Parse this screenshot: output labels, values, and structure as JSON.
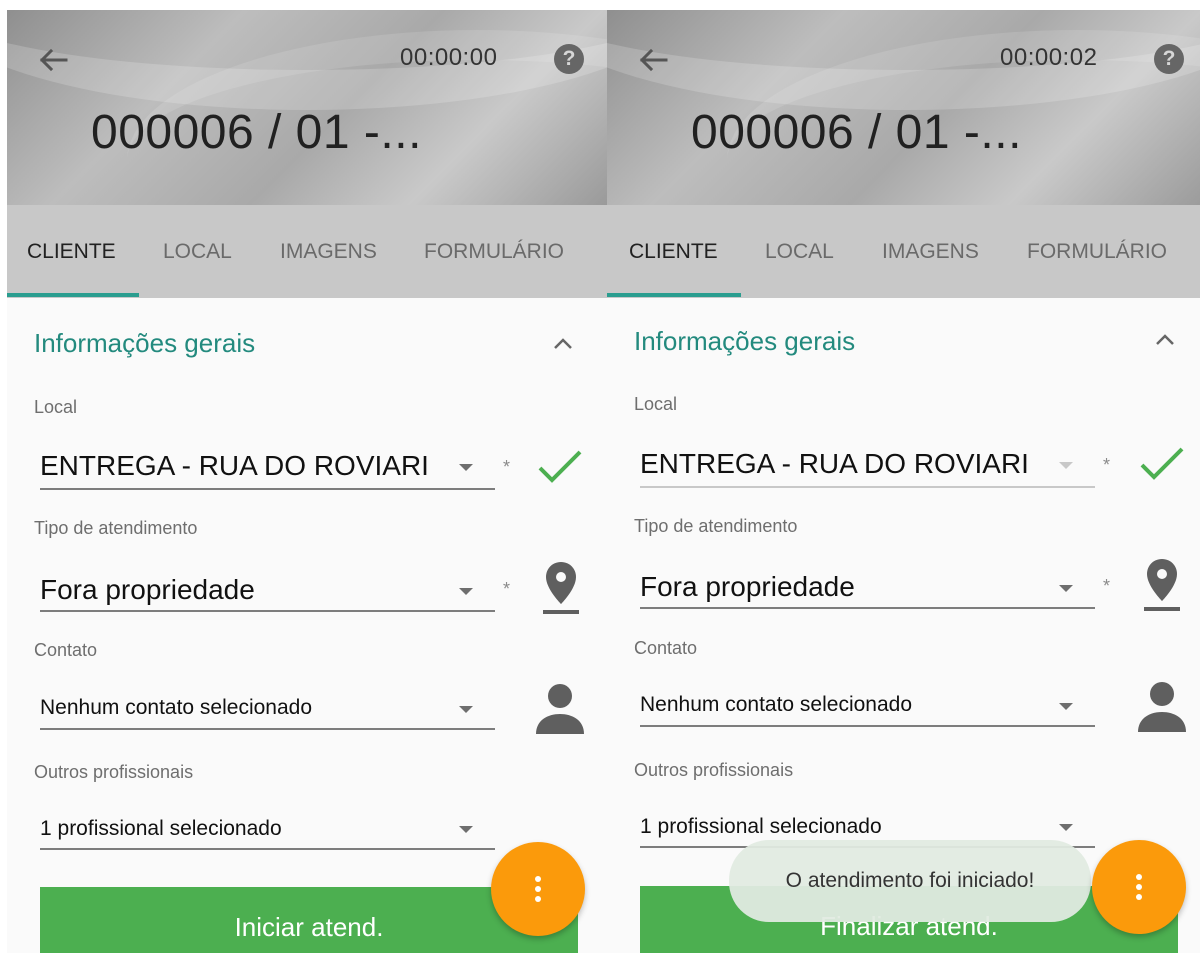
{
  "colors": {
    "accent_teal": "#238a7e",
    "primary_green": "#4caf50",
    "fab_orange": "#fb9a0b",
    "check_green": "#4caf50"
  },
  "screens": [
    {
      "timer": "00:00:00",
      "title": "000006 / 01 -...",
      "help_icon_text": "?",
      "tabs": [
        "CLIENTE",
        "LOCAL",
        "IMAGENS",
        "FORMULÁRIO"
      ],
      "active_tab": "CLIENTE",
      "section_title": "Informações gerais",
      "fields": {
        "local": {
          "label": "Local",
          "value": "ENTREGA - RUA DO ROVIARI",
          "required": "*"
        },
        "tipo": {
          "label": "Tipo de atendimento",
          "value": "Fora propriedade",
          "required": "*"
        },
        "contato": {
          "label": "Contato",
          "value": "Nenhum contato selecionado"
        },
        "outros": {
          "label": "Outros profissionais",
          "value": "1 profissional selecionado"
        }
      },
      "action_button": "Iniciar atend.",
      "toast": ""
    },
    {
      "timer": "00:00:02",
      "title": "000006 / 01 -...",
      "help_icon_text": "?",
      "tabs": [
        "CLIENTE",
        "LOCAL",
        "IMAGENS",
        "FORMULÁRIO"
      ],
      "active_tab": "CLIENTE",
      "section_title": "Informações gerais",
      "fields": {
        "local": {
          "label": "Local",
          "value": "ENTREGA - RUA DO ROVIARI",
          "required": "*"
        },
        "tipo": {
          "label": "Tipo de atendimento",
          "value": "Fora propriedade",
          "required": "*"
        },
        "contato": {
          "label": "Contato",
          "value": "Nenhum contato selecionado"
        },
        "outros": {
          "label": "Outros profissionais",
          "value": "1 profissional selecionado"
        }
      },
      "action_button": "Finalizar atend.",
      "toast": "O atendimento foi iniciado!"
    }
  ],
  "icons": {
    "back": "arrow-left-icon",
    "help": "help-circle-icon",
    "collapse": "chevron-up-icon",
    "valid": "checkmark-icon",
    "location": "map-pin-icon",
    "contact": "person-icon",
    "fab": "more-vertical-icon"
  }
}
